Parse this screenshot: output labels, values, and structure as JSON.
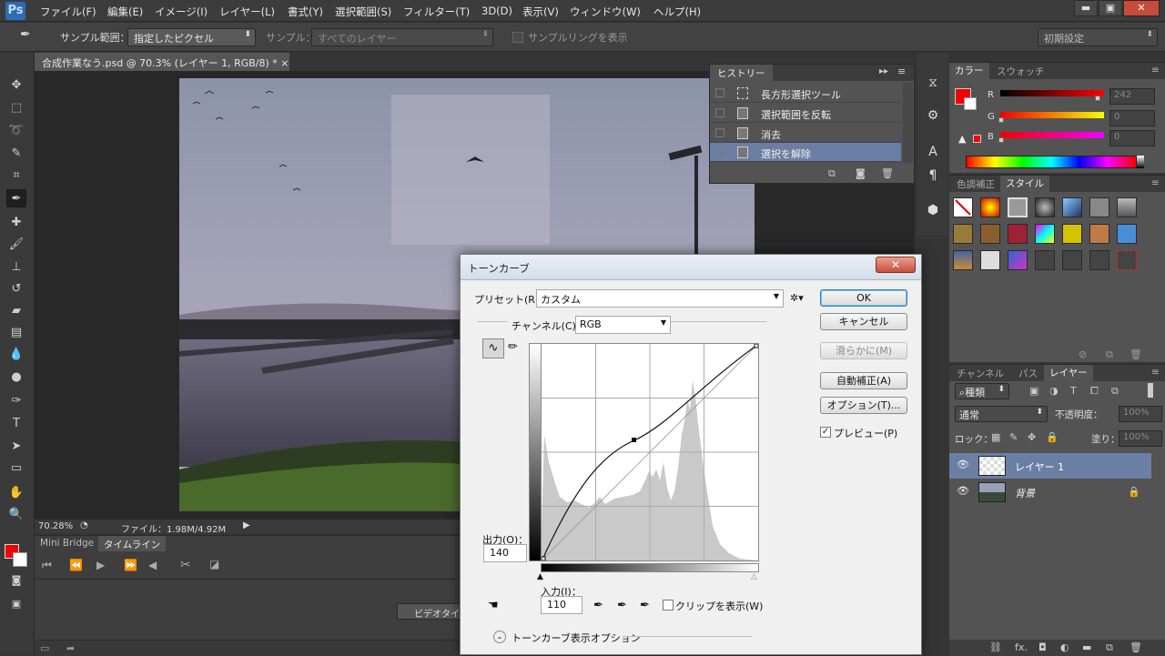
{
  "app": {
    "logo": "Ps"
  },
  "menu": [
    "ファイル(F)",
    "編集(E)",
    "イメージ(I)",
    "レイヤー(L)",
    "書式(Y)",
    "選択範囲(S)",
    "フィルター(T)",
    "3D(D)",
    "表示(V)",
    "ウィンドウ(W)",
    "ヘルプ(H)"
  ],
  "window_controls": {
    "minimize": "▬",
    "restore": "▣",
    "close": "✕"
  },
  "options": {
    "sample_size_label": "サンプル範囲：",
    "sample_size_value": "指定したピクセル",
    "sample_label": "サンプル：",
    "sample_value": "すべてのレイヤー",
    "show_ring": "サンプルリングを表示",
    "workspace": "初期設定"
  },
  "document": {
    "tab": "合成作業なう.psd @ 70.3% (レイヤー 1, RGB/8) *",
    "close": "×"
  },
  "status": {
    "zoom": "70.28%",
    "file_info": "ファイル：1.98M/4.92M"
  },
  "bottom_panel": {
    "tabs": [
      "Mini Bridge",
      "タイムライン"
    ],
    "video_button": "ビデオタイム"
  },
  "history": {
    "title": "ヒストリー",
    "items": [
      "長方形選択ツール",
      "選択範囲を反転",
      "消去",
      "選択を解除"
    ],
    "selected_index": 3
  },
  "color_panel": {
    "tabs": [
      "カラー",
      "スウォッチ"
    ],
    "channels": [
      {
        "label": "R",
        "value": "242"
      },
      {
        "label": "G",
        "value": "0"
      },
      {
        "label": "B",
        "value": "0"
      }
    ],
    "fg_color": "#f20000"
  },
  "styles_panel": {
    "tabs": [
      "色調補正",
      "スタイル"
    ]
  },
  "layers_panel": {
    "tabs": [
      "チャンネル",
      "パス",
      "レイヤー"
    ],
    "filter": "種類",
    "blend_mode": "通常",
    "opacity_label": "不透明度：",
    "opacity_value": "100%",
    "lock_label": "ロック：",
    "fill_label": "塗り：",
    "fill_value": "100%",
    "layers": [
      {
        "name": "レイヤー 1"
      },
      {
        "name": "背景"
      }
    ]
  },
  "curves_dialog": {
    "title": "トーンカーブ",
    "preset_label": "プリセット(R)：",
    "preset_value": "カスタム",
    "channel_label": "チャンネル(C)：",
    "channel_value": "RGB",
    "buttons": {
      "ok": "OK",
      "cancel": "キャンセル",
      "smooth": "滑らかに(M)",
      "auto": "自動補正(A)",
      "options": "オプション(T)..."
    },
    "preview_label": "プレビュー(P)",
    "preview_checked": true,
    "output_label": "出力(O)：",
    "output_value": "140",
    "input_label": "入力(I)：",
    "input_value": "110",
    "clip_label": "クリップを表示(W)",
    "display_options": "トーンカーブ表示オプション"
  }
}
